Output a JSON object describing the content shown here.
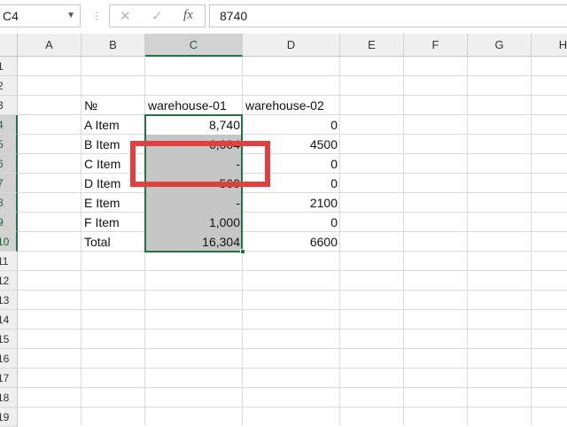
{
  "formula_bar": {
    "name_box": "C4",
    "cancel_icon": "✕",
    "enter_icon": "✓",
    "fx_label": "fx",
    "formula_value": "8740"
  },
  "columns": [
    "A",
    "B",
    "C",
    "D",
    "E",
    "F",
    "G",
    "H"
  ],
  "rows": [
    "1",
    "2",
    "3",
    "4",
    "5",
    "6",
    "7",
    "8",
    "9",
    "10",
    "11",
    "12",
    "13",
    "14",
    "15",
    "16",
    "17",
    "18",
    "19"
  ],
  "table": {
    "header": {
      "label": "№",
      "col_c": "warehouse-01",
      "col_d": "warehouse-02"
    },
    "rows": [
      {
        "label": "A Item",
        "c": "8,740",
        "d": "0"
      },
      {
        "label": "B Item",
        "c": "6,004",
        "d": "4500"
      },
      {
        "label": "C Item",
        "c": "-",
        "d": "0"
      },
      {
        "label": "D Item",
        "c": "560",
        "d": "0"
      },
      {
        "label": "E Item",
        "c": "-",
        "d": "2100"
      },
      {
        "label": "F Item",
        "c": "1,000",
        "d": "0"
      },
      {
        "label": "Total",
        "c": "16,304",
        "d": "6600"
      }
    ]
  },
  "colors": {
    "accent": "#217346",
    "annotation": "#e0403f",
    "selection": "#c6c6c6"
  }
}
